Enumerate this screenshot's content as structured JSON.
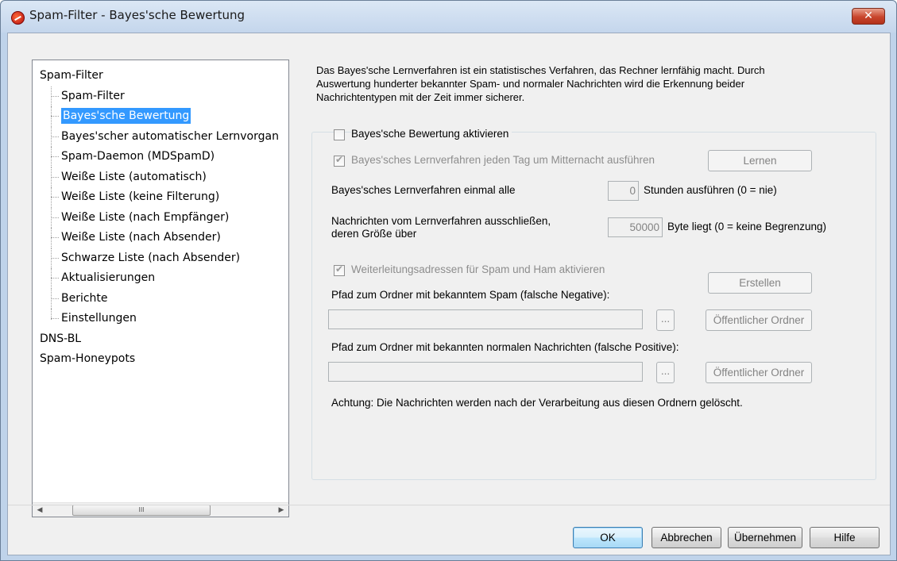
{
  "window": {
    "title": "Spam-Filter - Bayes'sche Bewertung",
    "close_label": "✕"
  },
  "tree": {
    "nodes": [
      {
        "label": "Spam-Filter"
      },
      {
        "label": "Spam-Filter"
      },
      {
        "label": "Bayes'sche Bewertung",
        "selected": true
      },
      {
        "label": "Bayes'scher automatischer Lernvorgan"
      },
      {
        "label": "Spam-Daemon (MDSpamD)"
      },
      {
        "label": "Weiße Liste (automatisch)"
      },
      {
        "label": "Weiße Liste (keine Filterung)"
      },
      {
        "label": "Weiße Liste (nach Empfänger)"
      },
      {
        "label": "Weiße Liste (nach Absender)"
      },
      {
        "label": "Schwarze Liste (nach Absender)"
      },
      {
        "label": "Aktualisierungen"
      },
      {
        "label": "Berichte"
      },
      {
        "label": "Einstellungen"
      },
      {
        "label": "DNS-BL"
      },
      {
        "label": "Spam-Honeypots"
      }
    ],
    "scroll_left": "◀",
    "scroll_right": "▶",
    "scroll_thumb": "III"
  },
  "description": {
    "line1": "Das Bayes'sche Lernverfahren ist ein statistisches Verfahren, das Rechner lernfähig macht. Durch",
    "line2": "Auswertung hunderter bekannter Spam- und normaler Nachrichten wird die Erkennung beider",
    "line3": "Nachrichtentypen mit der Zeit immer sicherer."
  },
  "form": {
    "enable_label": "Bayes'sche Bewertung aktivieren",
    "enable_checked": false,
    "midnight_label": "Bayes'sches Lernverfahren jeden Tag um Mitternacht ausführen",
    "midnight_checked": true,
    "learn_button": "Lernen",
    "interval_label": "Bayes'sches Lernverfahren einmal alle",
    "interval_value": "0",
    "interval_suffix": "Stunden ausführen (0 = nie)",
    "exclude_label_1": "Nachrichten vom Lernverfahren ausschließen,",
    "exclude_label_2": "deren Größe über",
    "exclude_value": "50000",
    "exclude_suffix": "Byte liegt (0 = keine Begrenzung)",
    "forward_label": "Weiterleitungsadressen für Spam und Ham aktivieren",
    "forward_checked": true,
    "create_button": "Erstellen",
    "spam_path_label": "Pfad zum Ordner mit bekanntem Spam (falsche Negative):",
    "spam_path_value": "",
    "browse_label": "...",
    "public_folder_button": "Öffentlicher Ordner",
    "ham_path_label": "Pfad zum Ordner mit bekannten normalen Nachrichten (falsche Positive):",
    "ham_path_value": "",
    "note": "Achtung: Die Nachrichten werden nach der Verarbeitung aus diesen Ordnern gelöscht."
  },
  "footer": {
    "ok": "OK",
    "cancel": "Abbrechen",
    "apply": "Übernehmen",
    "help": "Hilfe"
  }
}
